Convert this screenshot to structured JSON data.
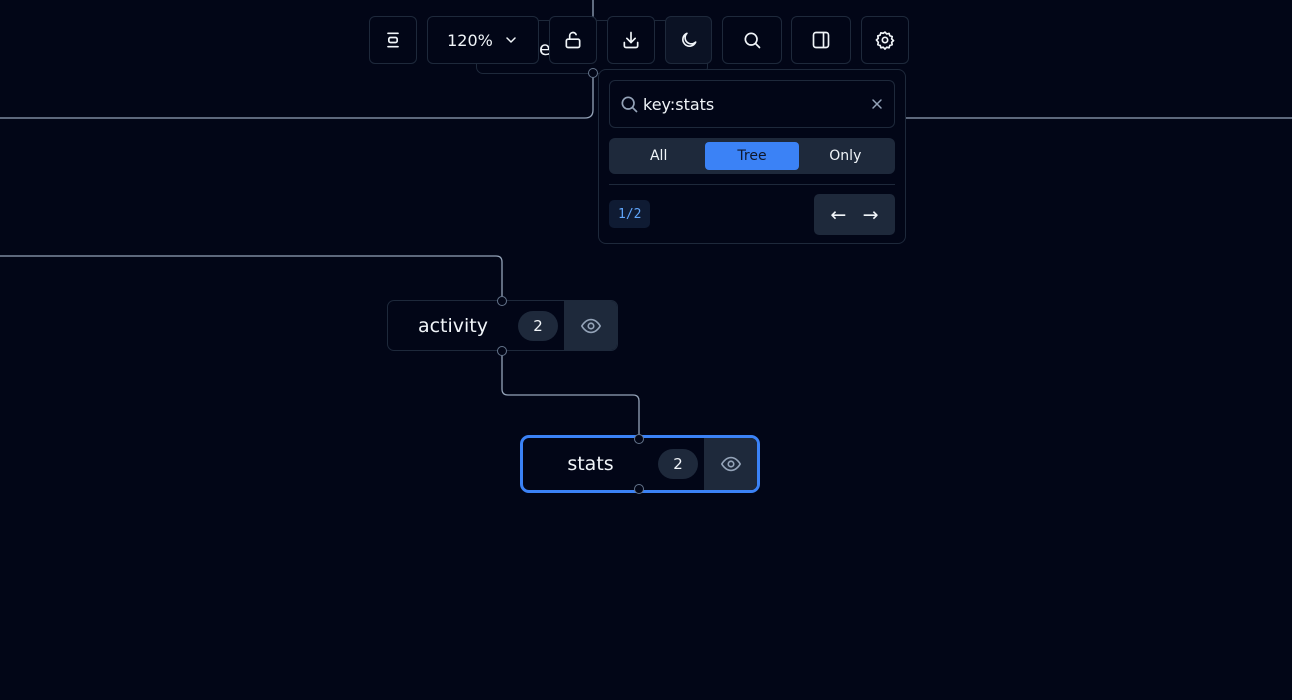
{
  "toolbar": {
    "zoom_value": "120%",
    "buttons": [
      "align-center-icon",
      "unlock-icon",
      "download-icon",
      "moon-icon",
      "search-icon",
      "sidebar-toggle-icon",
      "gear-icon"
    ]
  },
  "search": {
    "query": "key:stats",
    "modes": [
      "All",
      "Tree",
      "Only"
    ],
    "active_mode": "Tree",
    "match_counter": "1/2",
    "prev_label": "←",
    "next_label": "→"
  },
  "nodes": {
    "partial": {
      "label_fragment": "e"
    },
    "activity": {
      "label": "activity",
      "count": "2"
    },
    "stats": {
      "label": "stats",
      "count": "2"
    }
  },
  "colors": {
    "background": "#020617",
    "edge": "#94a3b8",
    "accent": "#3b82f6",
    "panel_border": "#1e293b"
  }
}
